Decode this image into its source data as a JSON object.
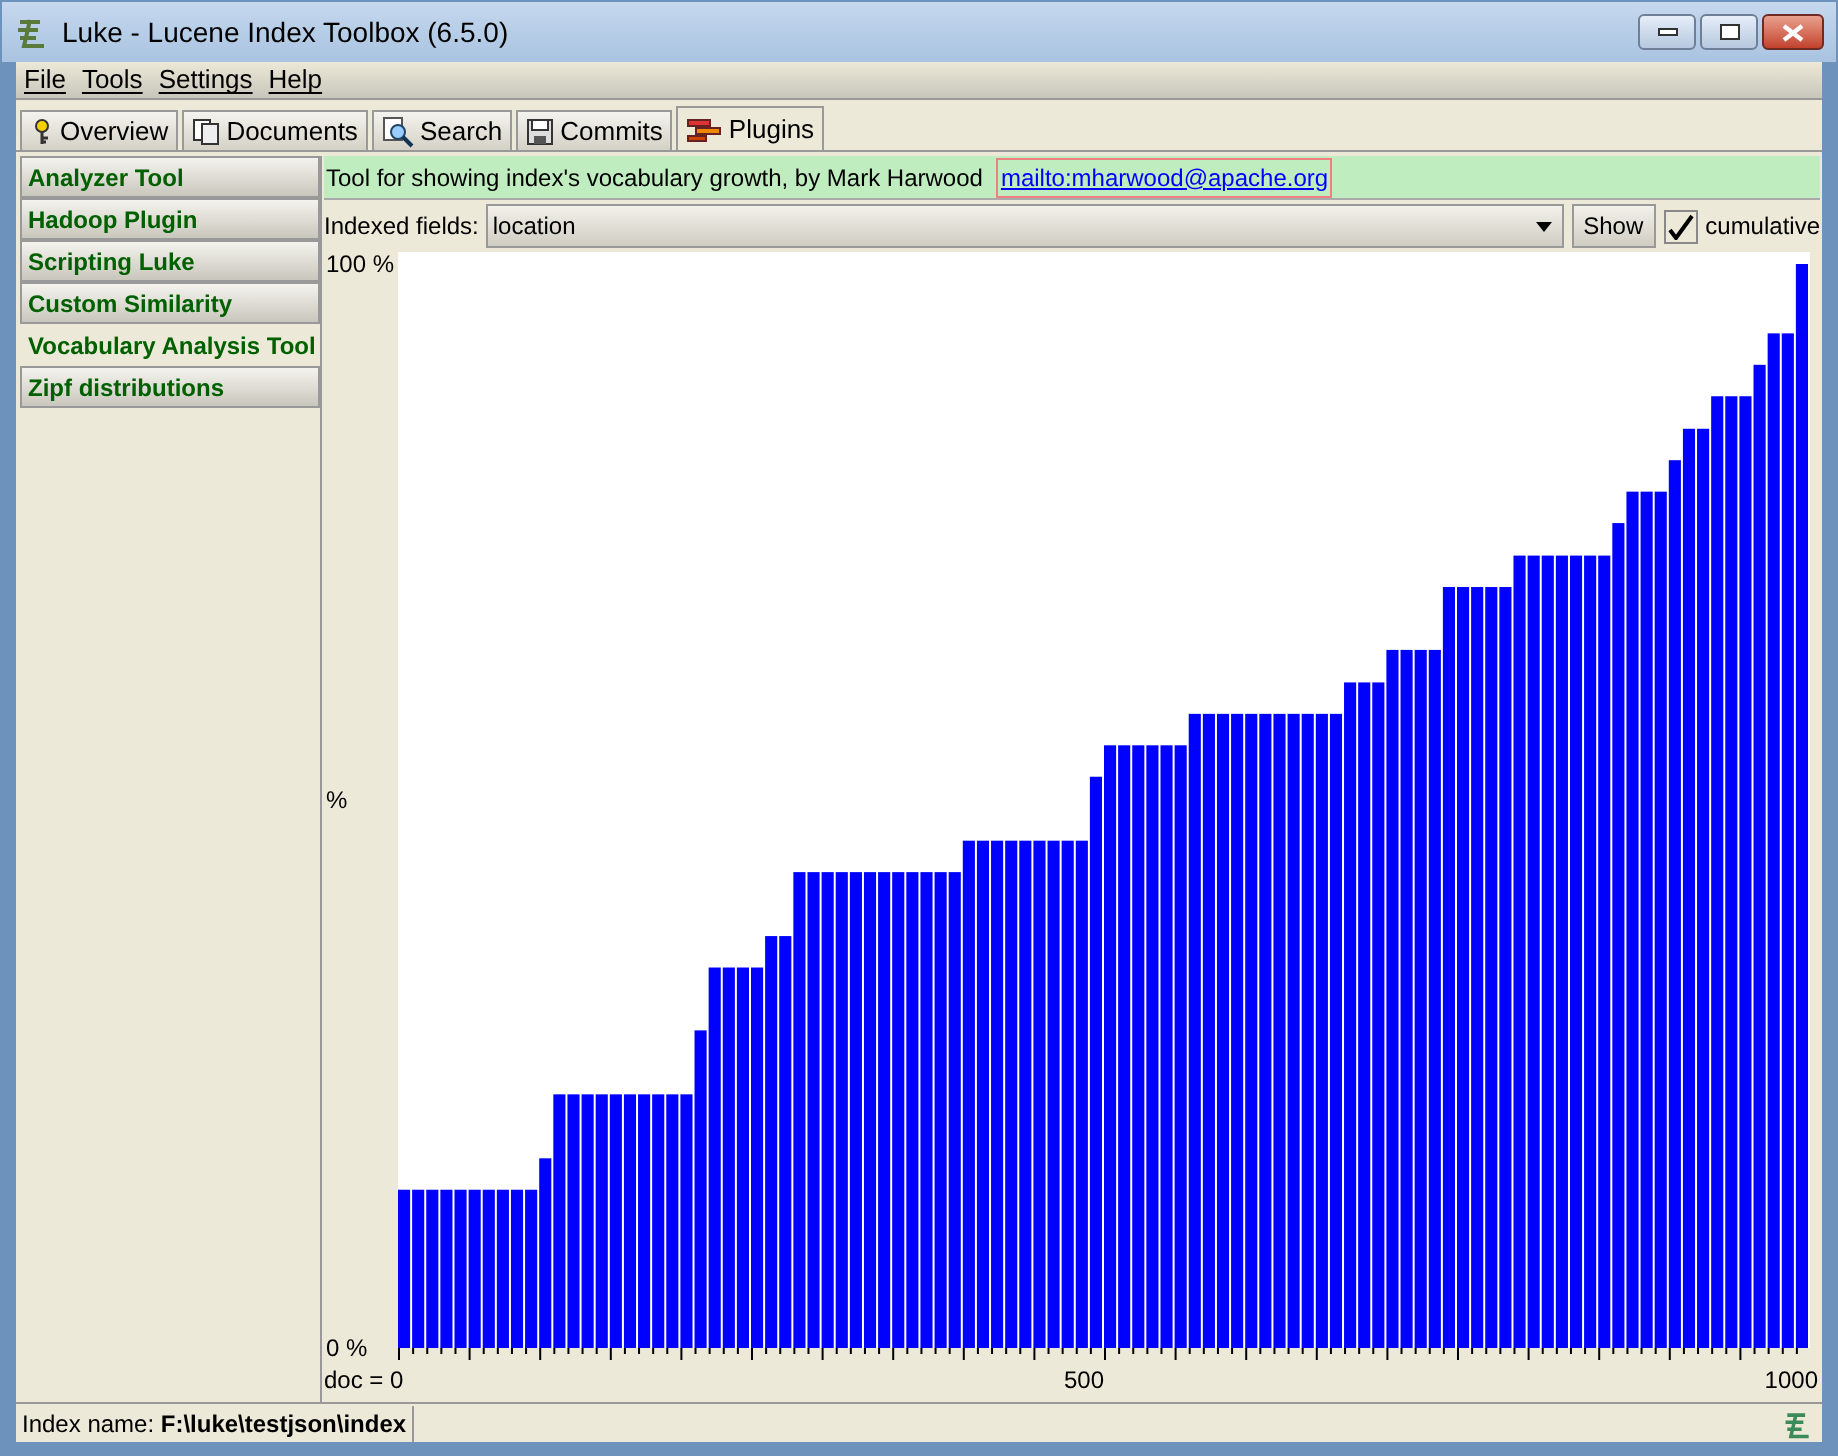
{
  "window": {
    "title": "Luke - Lucene Index Toolbox (6.5.0)"
  },
  "menu": [
    {
      "label": "File"
    },
    {
      "label": "Tools"
    },
    {
      "label": "Settings"
    },
    {
      "label": "Help"
    }
  ],
  "tabs": [
    {
      "label": "Overview",
      "selected": false,
      "kind": "overview"
    },
    {
      "label": "Documents",
      "selected": false,
      "kind": "documents"
    },
    {
      "label": "Search",
      "selected": false,
      "kind": "search"
    },
    {
      "label": "Commits",
      "selected": false,
      "kind": "commits"
    },
    {
      "label": "Plugins",
      "selected": true,
      "kind": "plugins"
    }
  ],
  "sidebar": {
    "items": [
      {
        "label": "Analyzer Tool",
        "selected": false
      },
      {
        "label": "Hadoop Plugin",
        "selected": false
      },
      {
        "label": "Scripting Luke",
        "selected": false
      },
      {
        "label": "Custom Similarity",
        "selected": false
      },
      {
        "label": "Vocabulary Analysis Tool",
        "selected": true
      },
      {
        "label": "Zipf distributions",
        "selected": false
      }
    ]
  },
  "plugin": {
    "description": "Tool for showing index's vocabulary growth, by Mark Harwood",
    "link": "mailto:mharwood@apache.org",
    "field_label": "Indexed fields:",
    "field_value": "location",
    "show_button": "Show",
    "cumulative": {
      "label": "cumulative",
      "checked": true
    },
    "x_axis_labels": [
      "doc = 0",
      "500",
      "1000"
    ],
    "chart_data": {
      "type": "bar",
      "ylabel": "%",
      "ylim": [
        0,
        100
      ],
      "yticks": [
        {
          "value": 0,
          "label": "0 %"
        },
        {
          "value": 100,
          "label": "100 %"
        }
      ],
      "series": [
        {
          "color": "#0000ff",
          "values": [
            14.6,
            14.6,
            14.6,
            14.6,
            14.6,
            14.6,
            14.6,
            14.6,
            14.6,
            14.6,
            17.5,
            23.4,
            23.4,
            23.4,
            23.4,
            23.4,
            23.4,
            23.4,
            23.4,
            23.4,
            23.4,
            29.3,
            35.1,
            35.1,
            35.1,
            35.1,
            38,
            38,
            43.9,
            43.9,
            43.9,
            43.9,
            43.9,
            43.9,
            43.9,
            43.9,
            43.9,
            43.9,
            43.9,
            43.9,
            46.8,
            46.8,
            46.8,
            46.8,
            46.8,
            46.8,
            46.8,
            46.8,
            46.8,
            52.7,
            55.6,
            55.6,
            55.6,
            55.6,
            55.6,
            55.6,
            58.5,
            58.5,
            58.5,
            58.5,
            58.5,
            58.5,
            58.5,
            58.5,
            58.5,
            58.5,
            58.5,
            61.4,
            61.4,
            61.4,
            64.4,
            64.4,
            64.4,
            64.4,
            70.2,
            70.2,
            70.2,
            70.2,
            70.2,
            73.1,
            73.1,
            73.1,
            73.1,
            73.1,
            73.1,
            73.1,
            76.1,
            79,
            79,
            79,
            81.9,
            84.8,
            84.8,
            87.8,
            87.8,
            87.8,
            90.7,
            93.6,
            93.6,
            100
          ]
        }
      ]
    }
  },
  "status_bar": {
    "text": "Index name: **F:\\luke\\testjson\\index**"
  }
}
